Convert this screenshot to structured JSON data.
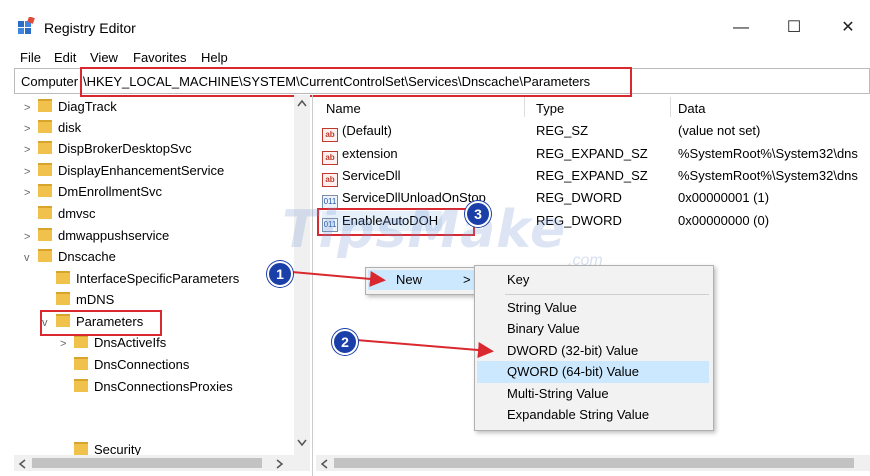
{
  "window": {
    "title": "Registry Editor",
    "minimize_glyph": "—",
    "maximize_glyph": "☐",
    "close_glyph": "✕"
  },
  "menu": [
    "File",
    "Edit",
    "View",
    "Favorites",
    "Help"
  ],
  "address": {
    "label": "Computer",
    "path": "\\HKEY_LOCAL_MACHINE\\SYSTEM\\CurrentControlSet\\Services\\Dnscache\\Parameters"
  },
  "tree": [
    {
      "label": "DiagTrack",
      "chev": ">"
    },
    {
      "label": "disk",
      "chev": ">"
    },
    {
      "label": "DispBrokerDesktopSvc",
      "chev": ">"
    },
    {
      "label": "DisplayEnhancementService",
      "chev": ">"
    },
    {
      "label": "DmEnrollmentSvc",
      "chev": ">"
    },
    {
      "label": "dmvsc",
      "chev": ""
    },
    {
      "label": "dmwappushservice",
      "chev": ">"
    },
    {
      "label": "Dnscache",
      "chev": "v"
    },
    {
      "label": "InterfaceSpecificParameters",
      "chev": ""
    },
    {
      "label": "mDNS",
      "chev": ""
    },
    {
      "label": "Parameters",
      "chev": "v"
    },
    {
      "label": "DnsActiveIfs",
      "chev": ">"
    },
    {
      "label": "DnsConnections",
      "chev": ""
    },
    {
      "label": "DnsConnectionsProxies",
      "chev": ""
    },
    {
      "label": "Security",
      "chev": ""
    }
  ],
  "columns": {
    "name": "Name",
    "type": "Type",
    "data": "Data"
  },
  "values": [
    {
      "name": "(Default)",
      "type": "REG_SZ",
      "data": "(value not set)",
      "icon": "ab"
    },
    {
      "name": "extension",
      "type": "REG_EXPAND_SZ",
      "data": "%SystemRoot%\\System32\\dns",
      "icon": "ab"
    },
    {
      "name": "ServiceDll",
      "type": "REG_EXPAND_SZ",
      "data": "%SystemRoot%\\System32\\dns",
      "icon": "ab"
    },
    {
      "name": "ServiceDllUnloadOnStop",
      "type": "REG_DWORD",
      "data": "0x00000001 (1)",
      "icon": "011"
    },
    {
      "name": "EnableAutoDOH",
      "type": "REG_DWORD",
      "data": "0x00000000 (0)",
      "icon": "011"
    }
  ],
  "context_menu": {
    "new_label": "New",
    "new_arrow": ">"
  },
  "submenu": [
    "Key",
    "String Value",
    "Binary Value",
    "DWORD (32-bit) Value",
    "QWORD (64-bit) Value",
    "Multi-String Value",
    "Expandable String Value"
  ],
  "badges": [
    "1",
    "2",
    "3"
  ],
  "watermark": {
    "text": "TipsMake",
    "suffix": ".com"
  },
  "colors": {
    "highlight": "#cce8ff",
    "annotation_red": "#d9292e",
    "badge_blue": "#1b3fa8"
  }
}
